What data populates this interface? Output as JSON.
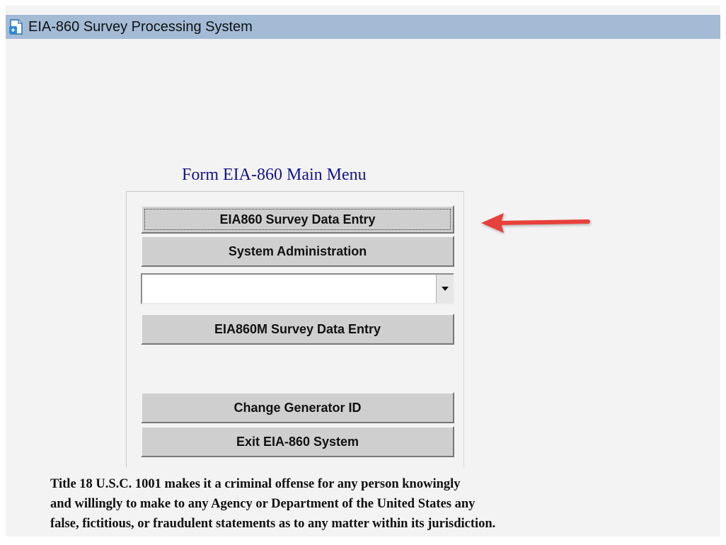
{
  "window": {
    "title": "EIA-860 Survey Processing System",
    "icon": "application-icon"
  },
  "menu": {
    "title": "Form EIA-860 Main Menu",
    "buttons": {
      "survey_data_entry": "EIA860 Survey Data Entry",
      "system_administration": "System Administration",
      "monthly_survey_data_entry": "EIA860M Survey Data Entry",
      "change_generator_id": "Change Generator ID",
      "exit_system": "Exit EIA-860 System"
    },
    "dropdown": {
      "selected_value": ""
    }
  },
  "annotation": {
    "arrow_color": "#e8413a"
  },
  "notice": {
    "lines": [
      "Title 18 U.S.C. 1001 makes it a criminal offense for any person knowingly",
      "and willingly to make to any Agency or Department of the United States  any",
      "false, fictitious, or fraudulent statements as to any matter within its jurisdiction."
    ]
  },
  "colors": {
    "titlebar": "#a4bbd6",
    "menu_title": "#14148a",
    "button_face": "#cfcfcf"
  }
}
